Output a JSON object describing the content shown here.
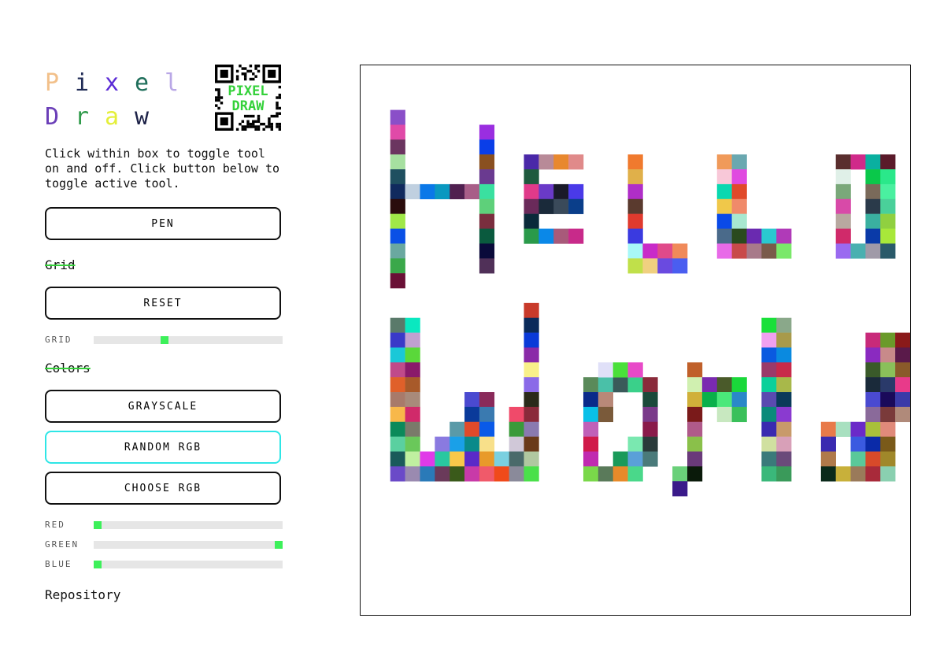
{
  "title": {
    "line1": [
      {
        "char": "P",
        "color": "#f2c08a"
      },
      {
        "char": "i",
        "color": "#1f2a55"
      },
      {
        "char": "x",
        "color": "#5b2bd6"
      },
      {
        "char": "e",
        "color": "#1e6e5a"
      },
      {
        "char": "l",
        "color": "#b9a7e6"
      }
    ],
    "line2": [
      {
        "char": "D",
        "color": "#6b3fb8"
      },
      {
        "char": "r",
        "color": "#2f9a4a"
      },
      {
        "char": "a",
        "color": "#e4ef3a"
      },
      {
        "char": "w",
        "color": "#1c2147"
      }
    ]
  },
  "qr": {
    "text_line1": "PIXEL",
    "text_line2": "DRAW",
    "text_color": "#34d13a"
  },
  "description": "Click within box to toggle tool on and off. Click button below to toggle active tool.",
  "buttons": {
    "pen": "PEN",
    "reset": "RESET",
    "grayscale": "GRAYSCALE",
    "random_rgb": "RANDOM RGB",
    "choose_rgb": "CHOOSE RGB"
  },
  "sections": {
    "grid": "Grid",
    "colors": "Colors"
  },
  "sliders": {
    "grid": {
      "label": "GRID",
      "value": 0.37
    },
    "red": {
      "label": "RED",
      "value": 0.0
    },
    "green": {
      "label": "GREEN",
      "value": 1.0
    },
    "blue": {
      "label": "BLUE",
      "value": 0.0
    }
  },
  "repo_link": "Repository",
  "accent_color": "#3df05a",
  "active_button_border": "#2ee6e6",
  "canvas": {
    "grid_cells": 37,
    "pixels": [
      [
        2,
        3,
        "#8a4fc8"
      ],
      [
        2,
        4,
        "#e04aa8"
      ],
      [
        2,
        5,
        "#6b3560"
      ],
      [
        2,
        6,
        "#a6e0a0"
      ],
      [
        2,
        7,
        "#1f4f60"
      ],
      [
        2,
        8,
        "#102a5e"
      ],
      [
        2,
        9,
        "#2a0c0c"
      ],
      [
        2,
        10,
        "#a0e848"
      ],
      [
        2,
        11,
        "#0a50e6"
      ],
      [
        2,
        12,
        "#6aa8a0"
      ],
      [
        2,
        13,
        "#3aa84a"
      ],
      [
        2,
        14,
        "#6a1036"
      ],
      [
        3,
        8,
        "#c0d0e0"
      ],
      [
        4,
        8,
        "#0a78e8"
      ],
      [
        5,
        8,
        "#0a98c0"
      ],
      [
        6,
        8,
        "#502050"
      ],
      [
        7,
        8,
        "#a85e88"
      ],
      [
        8,
        4,
        "#9a2ee0"
      ],
      [
        8,
        5,
        "#0a3ee8"
      ],
      [
        8,
        6,
        "#8a5020"
      ],
      [
        8,
        7,
        "#6a3a90"
      ],
      [
        8,
        8,
        "#3ae0a0"
      ],
      [
        8,
        9,
        "#5ed07a"
      ],
      [
        8,
        10,
        "#7a2e3e"
      ],
      [
        8,
        11,
        "#0a5a3e"
      ],
      [
        8,
        12,
        "#0a0a3a"
      ],
      [
        8,
        13,
        "#503058"
      ],
      [
        11,
        6,
        "#4a28a8"
      ],
      [
        12,
        6,
        "#b88a98"
      ],
      [
        13,
        6,
        "#e8882e"
      ],
      [
        14,
        6,
        "#e08a8a"
      ],
      [
        11,
        7,
        "#1e5a3e"
      ],
      [
        11,
        8,
        "#e03a8a"
      ],
      [
        12,
        8,
        "#6a3ac8"
      ],
      [
        13,
        8,
        "#1a1a2a"
      ],
      [
        14,
        8,
        "#4a3ae8"
      ],
      [
        11,
        9,
        "#6a2a5a"
      ],
      [
        12,
        9,
        "#1a2a3a"
      ],
      [
        13,
        9,
        "#3a4a5a"
      ],
      [
        14,
        9,
        "#0a3e8a"
      ],
      [
        11,
        10,
        "#0a2a3a"
      ],
      [
        11,
        11,
        "#2a9a4a"
      ],
      [
        12,
        11,
        "#0a88e8"
      ],
      [
        13,
        11,
        "#a85a7a"
      ],
      [
        14,
        11,
        "#c82a8a"
      ],
      [
        18,
        6,
        "#f07a2e"
      ],
      [
        18,
        7,
        "#e0b04a"
      ],
      [
        18,
        8,
        "#b02ec8"
      ],
      [
        18,
        9,
        "#5a3a2e"
      ],
      [
        18,
        10,
        "#e03a2e"
      ],
      [
        18,
        11,
        "#3a3ae0"
      ],
      [
        18,
        12,
        "#a8f8f8"
      ],
      [
        19,
        12,
        "#c82ac8"
      ],
      [
        20,
        12,
        "#e04a8a"
      ],
      [
        21,
        12,
        "#f08a5a"
      ],
      [
        18,
        13,
        "#c0e04a"
      ],
      [
        19,
        13,
        "#f0d080"
      ],
      [
        20,
        13,
        "#6a4ae0"
      ],
      [
        21,
        13,
        "#4a5ef0"
      ],
      [
        24,
        6,
        "#f09a5a"
      ],
      [
        25,
        6,
        "#6aa8b0"
      ],
      [
        24,
        7,
        "#f8c8d8"
      ],
      [
        25,
        7,
        "#e04ae0"
      ],
      [
        24,
        8,
        "#0ad8b0"
      ],
      [
        25,
        8,
        "#e04a2a"
      ],
      [
        24,
        9,
        "#f0c84a"
      ],
      [
        25,
        9,
        "#f08a6a"
      ],
      [
        24,
        10,
        "#0a4ae8"
      ],
      [
        25,
        10,
        "#a8e8d0"
      ],
      [
        24,
        11,
        "#4a6a8a"
      ],
      [
        25,
        11,
        "#2a4a1e"
      ],
      [
        26,
        11,
        "#6a2ab0"
      ],
      [
        27,
        11,
        "#2ac8d0"
      ],
      [
        28,
        11,
        "#b03ab8"
      ],
      [
        24,
        12,
        "#e86ae8"
      ],
      [
        25,
        12,
        "#c84a4a"
      ],
      [
        26,
        12,
        "#a87a8a"
      ],
      [
        27,
        12,
        "#7a5a4a"
      ],
      [
        28,
        12,
        "#7ae86a"
      ],
      [
        32,
        6,
        "#5a2e2e"
      ],
      [
        33,
        6,
        "#d02a8a"
      ],
      [
        34,
        6,
        "#0ab0a0"
      ],
      [
        35,
        6,
        "#5a1a2a"
      ],
      [
        32,
        7,
        "#e0f0e8"
      ],
      [
        34,
        7,
        "#0ac84a"
      ],
      [
        35,
        7,
        "#2ae88a"
      ],
      [
        32,
        8,
        "#7aa87a"
      ],
      [
        34,
        8,
        "#7a6a5a"
      ],
      [
        35,
        8,
        "#4af0a0"
      ],
      [
        32,
        9,
        "#d84aa8"
      ],
      [
        34,
        9,
        "#2a3a4a"
      ],
      [
        35,
        9,
        "#4ad09a"
      ],
      [
        32,
        10,
        "#b8a8a0"
      ],
      [
        34,
        10,
        "#3ab0a0"
      ],
      [
        35,
        10,
        "#90d040"
      ],
      [
        32,
        11,
        "#d02a6a"
      ],
      [
        34,
        11,
        "#0a3aa8"
      ],
      [
        35,
        11,
        "#a8e83a"
      ],
      [
        32,
        12,
        "#9a6af0"
      ],
      [
        33,
        12,
        "#4ab0b0"
      ],
      [
        34,
        12,
        "#a09aa8"
      ],
      [
        35,
        12,
        "#2a5a6a"
      ],
      [
        2,
        17,
        "#5a7a6a"
      ],
      [
        3,
        17,
        "#0ae8c0"
      ],
      [
        2,
        18,
        "#3a3ac8"
      ],
      [
        3,
        18,
        "#c0a0d0"
      ],
      [
        2,
        19,
        "#1ac8d8"
      ],
      [
        3,
        19,
        "#5ad83a"
      ],
      [
        2,
        20,
        "#c04a8a"
      ],
      [
        3,
        20,
        "#8a1a6a"
      ],
      [
        2,
        21,
        "#e0602a"
      ],
      [
        3,
        21,
        "#a85a2a"
      ],
      [
        2,
        22,
        "#a87a6a"
      ],
      [
        3,
        22,
        "#a88a7a"
      ],
      [
        2,
        23,
        "#f8b84a"
      ],
      [
        3,
        23,
        "#d02a6a"
      ],
      [
        2,
        24,
        "#0a8a5a"
      ],
      [
        3,
        24,
        "#7a7a6a"
      ],
      [
        2,
        25,
        "#5ad0a0"
      ],
      [
        3,
        25,
        "#6ac85a"
      ],
      [
        2,
        26,
        "#1a5a5a"
      ],
      [
        3,
        26,
        "#c0f0a0"
      ],
      [
        2,
        27,
        "#6a4ac8"
      ],
      [
        3,
        27,
        "#9a8ab0"
      ],
      [
        4,
        26,
        "#e03ae8"
      ],
      [
        5,
        25,
        "#8a7ae0"
      ],
      [
        5,
        26,
        "#2ac8a0"
      ],
      [
        4,
        27,
        "#2a7ab8"
      ],
      [
        5,
        27,
        "#6a3a5a"
      ],
      [
        6,
        24,
        "#5a9aa8"
      ],
      [
        6,
        25,
        "#1aa0e8"
      ],
      [
        6,
        26,
        "#f8c84a"
      ],
      [
        6,
        27,
        "#3a5a1a"
      ],
      [
        7,
        22,
        "#4a4ad0"
      ],
      [
        7,
        23,
        "#0a3a9a"
      ],
      [
        7,
        24,
        "#e04a2a"
      ],
      [
        7,
        25,
        "#0a8a8a"
      ],
      [
        7,
        26,
        "#5a2ac8"
      ],
      [
        7,
        27,
        "#c83aa8"
      ],
      [
        8,
        22,
        "#8a2a5a"
      ],
      [
        8,
        23,
        "#3a7ab0"
      ],
      [
        8,
        24,
        "#0a5ae8"
      ],
      [
        8,
        25,
        "#f8e08a"
      ],
      [
        8,
        26,
        "#e89a2a"
      ],
      [
        8,
        27,
        "#f05a6a"
      ],
      [
        9,
        26,
        "#7ad0e0"
      ],
      [
        9,
        27,
        "#f04a1a"
      ],
      [
        10,
        23,
        "#f04a6a"
      ],
      [
        10,
        24,
        "#3a9a3a"
      ],
      [
        10,
        25,
        "#d0c8d8"
      ],
      [
        10,
        26,
        "#4a6a6a"
      ],
      [
        10,
        27,
        "#8a8a9a"
      ],
      [
        11,
        16,
        "#c83a2a"
      ],
      [
        11,
        17,
        "#0a2a5a"
      ],
      [
        11,
        18,
        "#0a3ad8"
      ],
      [
        11,
        19,
        "#8a2aa8"
      ],
      [
        11,
        20,
        "#f8f08a"
      ],
      [
        11,
        21,
        "#8a6ae8"
      ],
      [
        11,
        22,
        "#2a2a1a"
      ],
      [
        11,
        23,
        "#8a2a3a"
      ],
      [
        11,
        24,
        "#8a7ab0"
      ],
      [
        11,
        25,
        "#6a3a1a"
      ],
      [
        11,
        26,
        "#b0c8a0"
      ],
      [
        11,
        27,
        "#4ae04a"
      ],
      [
        15,
        21,
        "#5a8a5a"
      ],
      [
        16,
        21,
        "#4ac0a8"
      ],
      [
        17,
        21,
        "#3a5a5a"
      ],
      [
        18,
        21,
        "#3ad08a"
      ],
      [
        19,
        21,
        "#8a2a3a"
      ],
      [
        15,
        22,
        "#0a2a8a"
      ],
      [
        16,
        22,
        "#b88878"
      ],
      [
        19,
        22,
        "#1a4a3a"
      ],
      [
        15,
        23,
        "#0ac0e8"
      ],
      [
        16,
        23,
        "#7a5a3a"
      ],
      [
        19,
        23,
        "#7a3a8a"
      ],
      [
        15,
        24,
        "#c060b8"
      ],
      [
        19,
        24,
        "#8a1a4a"
      ],
      [
        15,
        25,
        "#d01a4a"
      ],
      [
        18,
        25,
        "#7ae8b0"
      ],
      [
        19,
        25,
        "#2a3a3a"
      ],
      [
        15,
        26,
        "#c02ab0"
      ],
      [
        17,
        26,
        "#1a9a5a"
      ],
      [
        18,
        26,
        "#5aa0d8"
      ],
      [
        19,
        26,
        "#4a7a7a"
      ],
      [
        15,
        27,
        "#7ad84a"
      ],
      [
        16,
        27,
        "#5a7a5a"
      ],
      [
        17,
        27,
        "#e88a2a"
      ],
      [
        18,
        27,
        "#4ad88a"
      ],
      [
        16,
        20,
        "#e0e0f8"
      ],
      [
        17,
        20,
        "#4ae03a"
      ],
      [
        18,
        20,
        "#e84ac8"
      ],
      [
        22,
        20,
        "#c0602a"
      ],
      [
        22,
        21,
        "#d0f0b0"
      ],
      [
        23,
        21,
        "#7a2ab0"
      ],
      [
        24,
        21,
        "#4a5a2a"
      ],
      [
        25,
        21,
        "#1ad83a"
      ],
      [
        22,
        22,
        "#d0b03a"
      ],
      [
        23,
        22,
        "#0ab04a"
      ],
      [
        24,
        22,
        "#4ae87a"
      ],
      [
        25,
        22,
        "#2a88c8"
      ],
      [
        22,
        23,
        "#7a1a1a"
      ],
      [
        24,
        23,
        "#c8e8c0"
      ],
      [
        25,
        23,
        "#3ac05a"
      ],
      [
        22,
        24,
        "#b05a8a"
      ],
      [
        22,
        25,
        "#8ac04a"
      ],
      [
        22,
        26,
        "#6a3a7a"
      ],
      [
        21,
        27,
        "#6ad07a"
      ],
      [
        22,
        27,
        "#0a1a0a"
      ],
      [
        21,
        28,
        "#3a1a8a"
      ],
      [
        27,
        17,
        "#1ae03a"
      ],
      [
        28,
        17,
        "#8aa88a"
      ],
      [
        27,
        18,
        "#f0a0f0"
      ],
      [
        28,
        18,
        "#a89a4a"
      ],
      [
        27,
        19,
        "#0a5ae0"
      ],
      [
        28,
        19,
        "#0a8ae0"
      ],
      [
        27,
        20,
        "#9a3a6a"
      ],
      [
        28,
        20,
        "#c82a4a"
      ],
      [
        27,
        21,
        "#0ad09a"
      ],
      [
        28,
        21,
        "#a8b84a"
      ],
      [
        27,
        22,
        "#5a4ab0"
      ],
      [
        28,
        22,
        "#0a3a5a"
      ],
      [
        27,
        23,
        "#0a8a7a"
      ],
      [
        28,
        23,
        "#8a3ad0"
      ],
      [
        27,
        24,
        "#3a2ab0"
      ],
      [
        28,
        24,
        "#c89a6a"
      ],
      [
        27,
        25,
        "#d0e0a0"
      ],
      [
        28,
        25,
        "#d8a0b8"
      ],
      [
        27,
        26,
        "#3a7a7a"
      ],
      [
        28,
        26,
        "#6a4a7a"
      ],
      [
        27,
        27,
        "#3ab87a"
      ],
      [
        28,
        27,
        "#3a9a5a"
      ],
      [
        31,
        24,
        "#e87a4a"
      ],
      [
        32,
        24,
        "#a8e0c0"
      ],
      [
        33,
        24,
        "#6a2ac8"
      ],
      [
        34,
        24,
        "#a8c03a"
      ],
      [
        35,
        24,
        "#e08a7a"
      ],
      [
        31,
        25,
        "#3a2ab0"
      ],
      [
        33,
        25,
        "#3a5ae0"
      ],
      [
        34,
        25,
        "#0a2aa8"
      ],
      [
        35,
        25,
        "#7a5a1a"
      ],
      [
        31,
        26,
        "#b07a4a"
      ],
      [
        33,
        26,
        "#5ac89a"
      ],
      [
        34,
        26,
        "#d84a2a"
      ],
      [
        35,
        26,
        "#a0882a"
      ],
      [
        31,
        27,
        "#0a2a1a"
      ],
      [
        32,
        27,
        "#c8b03a"
      ],
      [
        33,
        27,
        "#9a7a5a"
      ],
      [
        34,
        27,
        "#a82a3a"
      ],
      [
        35,
        27,
        "#8ad0b0"
      ],
      [
        34,
        18,
        "#c82a7a"
      ],
      [
        35,
        18,
        "#6a9a2a"
      ],
      [
        36,
        18,
        "#8a1a1a"
      ],
      [
        34,
        19,
        "#8a2ac0"
      ],
      [
        35,
        19,
        "#c88a8a"
      ],
      [
        36,
        19,
        "#5a1a4a"
      ],
      [
        34,
        20,
        "#3a5a2a"
      ],
      [
        35,
        20,
        "#8ac05a"
      ],
      [
        36,
        20,
        "#8a5a2a"
      ],
      [
        34,
        21,
        "#1a2a3a"
      ],
      [
        35,
        21,
        "#2a3a6a"
      ],
      [
        36,
        21,
        "#e83a8a"
      ],
      [
        34,
        22,
        "#4a4ad0"
      ],
      [
        35,
        22,
        "#1a0a5a"
      ],
      [
        36,
        22,
        "#3a3aa8"
      ],
      [
        34,
        23,
        "#8a6a9a"
      ],
      [
        35,
        23,
        "#7a3a3a"
      ],
      [
        36,
        23,
        "#b08a7a"
      ]
    ]
  }
}
